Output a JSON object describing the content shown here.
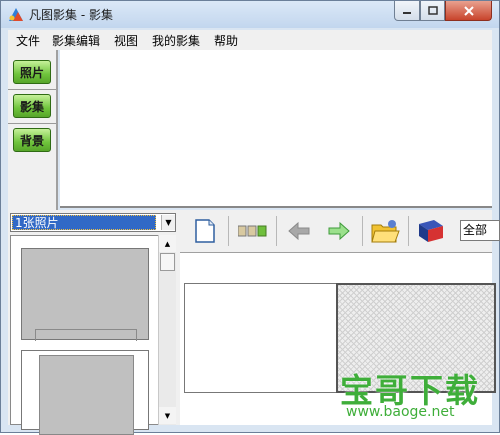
{
  "window": {
    "title": "凡图影集 - 影集"
  },
  "menu": [
    "文件",
    "影集编辑",
    "视图",
    "我的影集",
    "帮助"
  ],
  "left_buttons": [
    "照片",
    "影集",
    "背景"
  ],
  "photo_select": {
    "value": "1张照片"
  },
  "toolbar": {
    "view_combo": "全部"
  },
  "watermark": {
    "text": "宝哥下载",
    "url": "www.baoge.net"
  },
  "icons": {
    "app": "app-logo-icon",
    "new": "blank-page-icon",
    "layout": "layout-thumbnails-icon",
    "back": "arrow-left-icon",
    "forward": "arrow-right-icon",
    "open": "open-folder-icon",
    "album": "album-book-icon"
  },
  "colors": {
    "accent_green": "#6fc43c",
    "selection_blue": "#3169c6",
    "watermark_green": "#3fae3a"
  }
}
